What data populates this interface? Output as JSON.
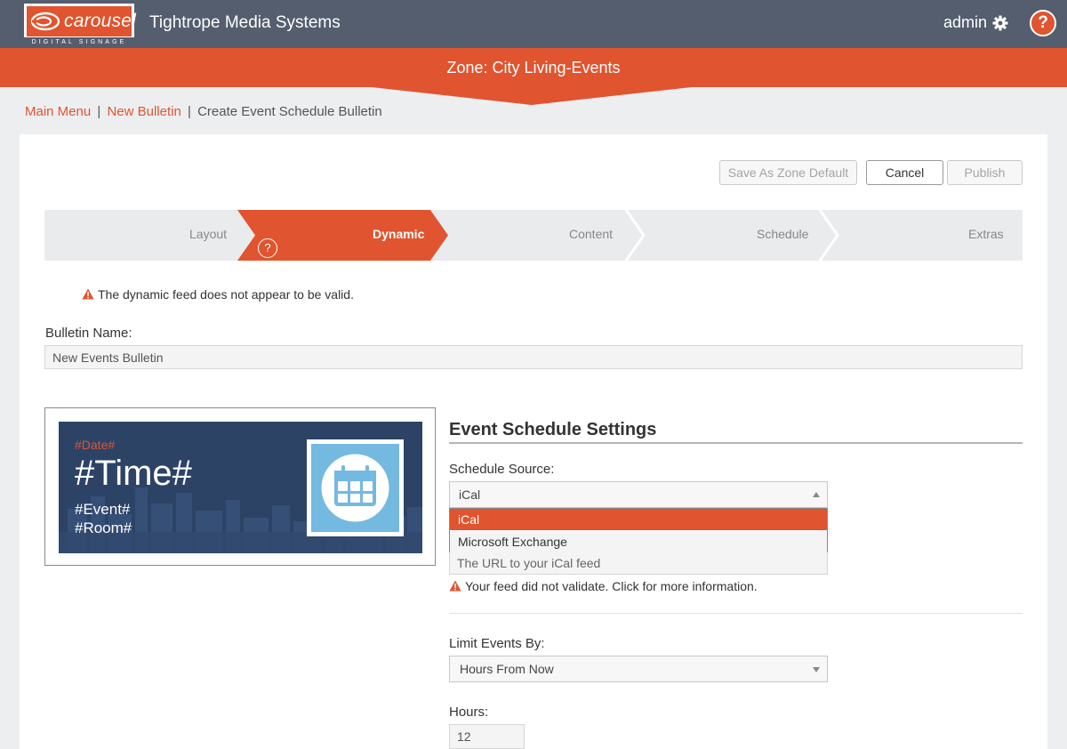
{
  "header": {
    "logo_word": "carousel",
    "logo_sub": "DIGITAL SIGNAGE",
    "app_title": "Tightrope Media Systems",
    "user": "admin",
    "help_glyph": "?"
  },
  "zone": {
    "title": "Zone: City Living-Events"
  },
  "breadcrumb": {
    "main_menu": "Main Menu",
    "new_bulletin": "New Bulletin",
    "current": "Create Event Schedule Bulletin",
    "separator": "|"
  },
  "actions": {
    "save_zone_default": "Save As Zone Default",
    "cancel": "Cancel",
    "publish": "Publish"
  },
  "steps": [
    {
      "label": "Layout",
      "state": "done"
    },
    {
      "label": "Dynamic",
      "state": "active"
    },
    {
      "label": "Content",
      "state": "pending"
    },
    {
      "label": "Schedule",
      "state": "pending"
    },
    {
      "label": "Extras",
      "state": "pending"
    }
  ],
  "step_help": "?",
  "warnings": {
    "feed_invalid": "The dynamic feed does not appear to be valid.",
    "feed_not_validated": "Your feed did not validate. Click for more information."
  },
  "bulletin_name": {
    "label": "Bulletin Name:",
    "value": "New Events Bulletin"
  },
  "preview": {
    "date": "#Date#",
    "time": "#Time#",
    "event": "#Event#",
    "room": "#Room#"
  },
  "settings": {
    "title": "Event Schedule Settings",
    "schedule_source": {
      "label": "Schedule Source:",
      "value": "iCal",
      "options": [
        "iCal",
        "Microsoft Exchange"
      ]
    },
    "url": {
      "placeholder": "The URL to your iCal feed"
    },
    "limit_events": {
      "label": "Limit Events By:",
      "value": "Hours From Now"
    },
    "hours": {
      "label": "Hours:",
      "value": "12"
    }
  },
  "colors": {
    "accent": "#e0542f",
    "topbar": "#545e6e",
    "step_inactive": "#eaebed",
    "preview_bg": "#2c4366",
    "calendar_tile": "#74b9e0"
  }
}
